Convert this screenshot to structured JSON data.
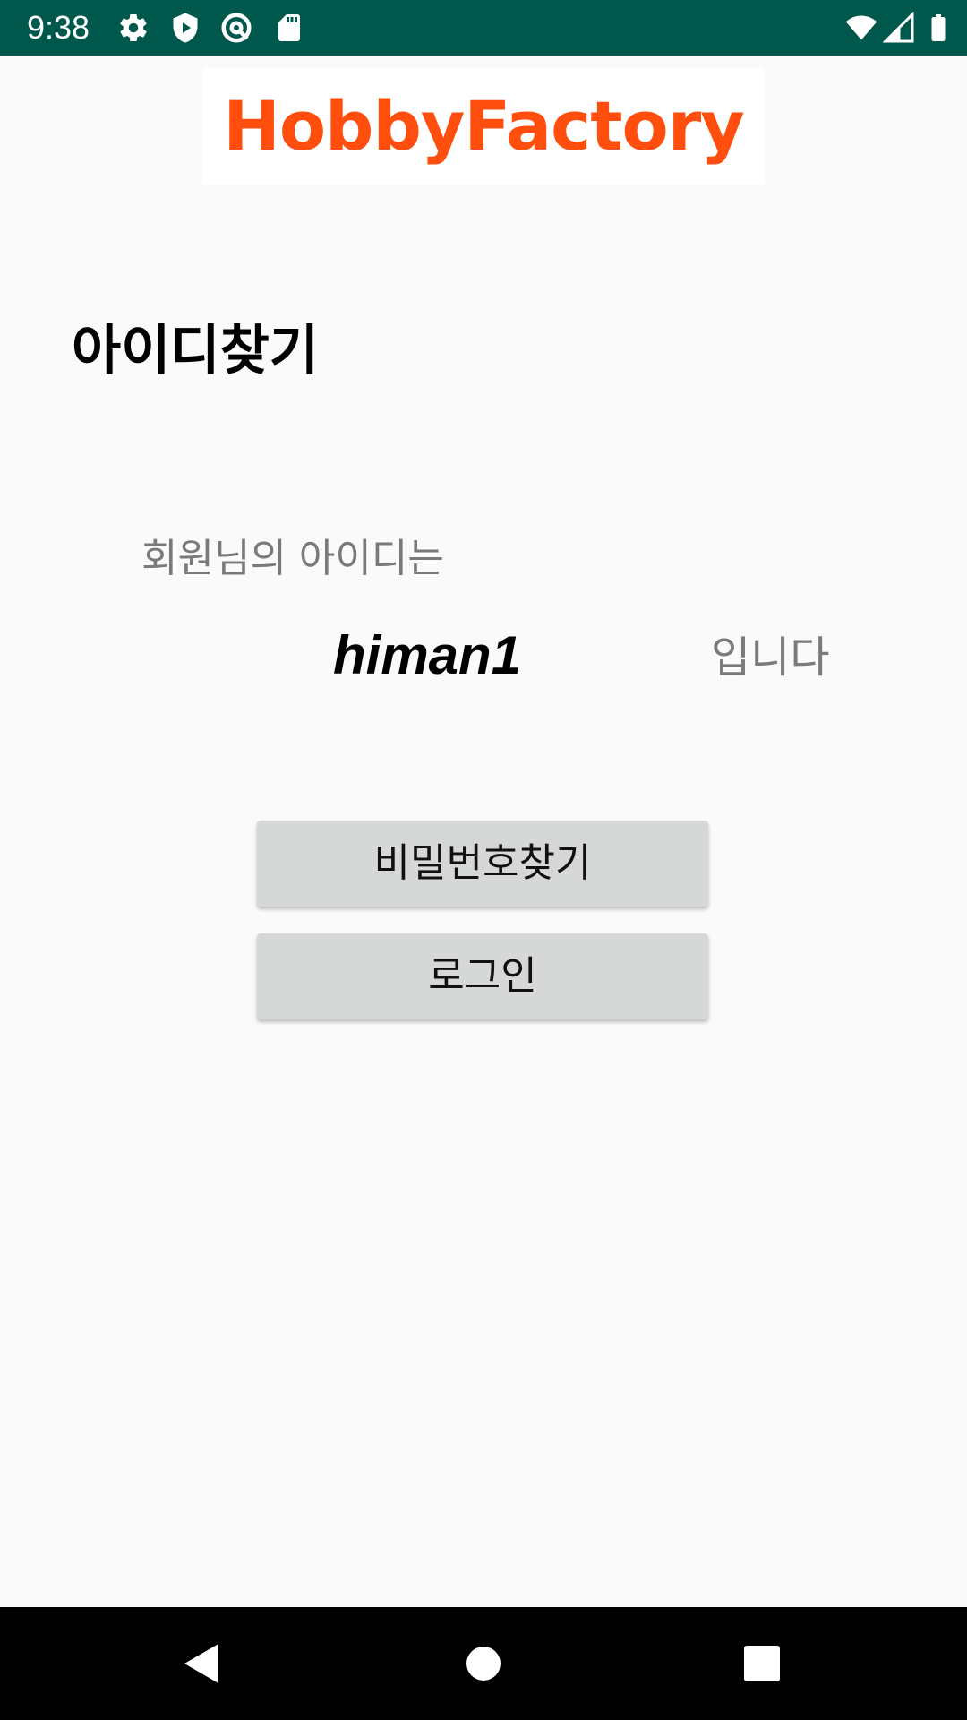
{
  "status_bar": {
    "time": "9:38",
    "icons_left": [
      "gear-icon",
      "shield-play-icon",
      "vpn-key-icon",
      "sd-card-icon"
    ],
    "icons_right": [
      "wifi-icon",
      "signal-icon",
      "battery-icon"
    ],
    "background_color": "#00574b"
  },
  "logo": {
    "text": "HobbyFactory",
    "color": "#ff4e0e"
  },
  "page": {
    "title": "아이디찾기",
    "message_prefix": "회원님의 아이디는",
    "found_id": "himan1",
    "message_suffix": "입니다"
  },
  "buttons": {
    "find_password_label": "비밀번호찾기",
    "login_label": "로그인"
  },
  "nav_bar": {
    "items": [
      "back-icon",
      "home-icon",
      "recents-icon"
    ]
  }
}
